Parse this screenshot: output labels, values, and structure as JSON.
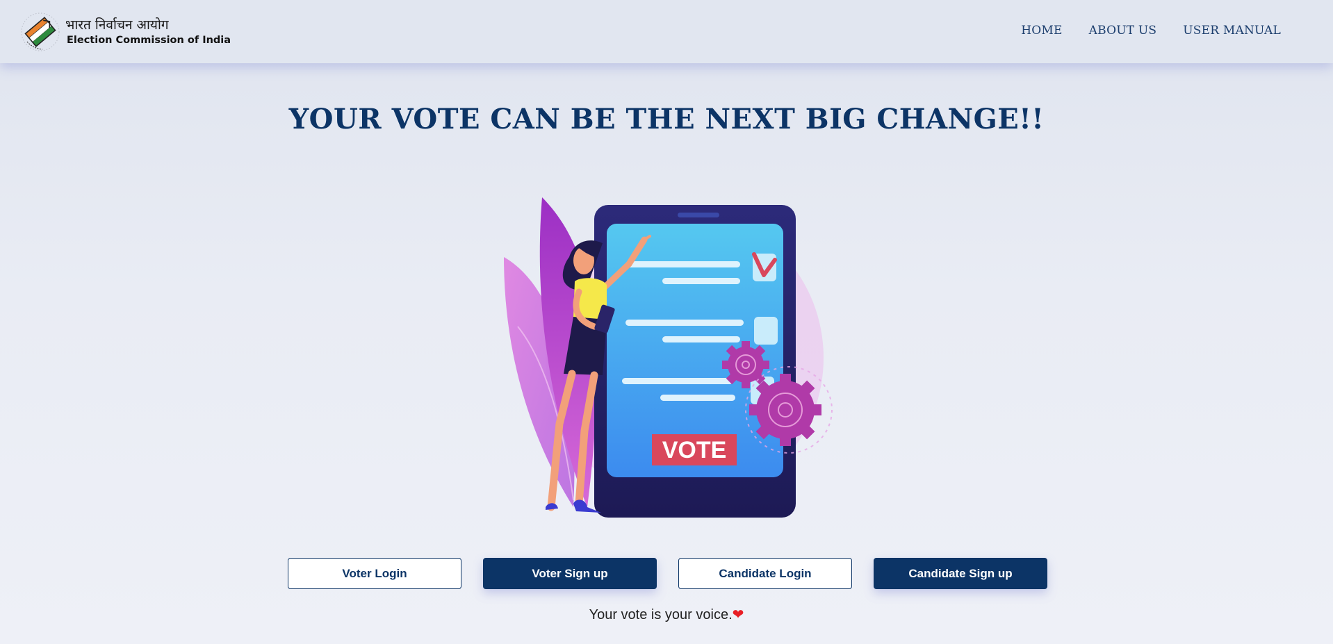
{
  "header": {
    "brand_hindi": "भारत निर्वाचन आयोग",
    "brand_english": "Election Commission of India",
    "logo_icon": "eci-logo-icon",
    "nav": [
      {
        "label": "HOME"
      },
      {
        "label": "ABOUT US"
      },
      {
        "label": "USER MANUAL"
      }
    ]
  },
  "main": {
    "headline": "YOUR VOTE CAN BE THE NEXT BIG CHANGE!!",
    "illustration": {
      "icon": "voting-phone-illustration",
      "vote_label": "VOTE"
    },
    "buttons": [
      {
        "label": "Voter Login",
        "style": "outline"
      },
      {
        "label": "Voter Sign up",
        "style": "solid"
      },
      {
        "label": "Candidate Login",
        "style": "outline"
      },
      {
        "label": "Candidate Sign up",
        "style": "solid"
      }
    ],
    "tagline": "Your vote is your voice.",
    "tagline_icon": "heart-icon",
    "heart_glyph": "❤"
  },
  "colors": {
    "primary": "#0c3466",
    "nav_text": "#1d3f6e",
    "background": "#e9ecf4",
    "heart": "#e81e25",
    "vote_badge": "#d9475c"
  }
}
